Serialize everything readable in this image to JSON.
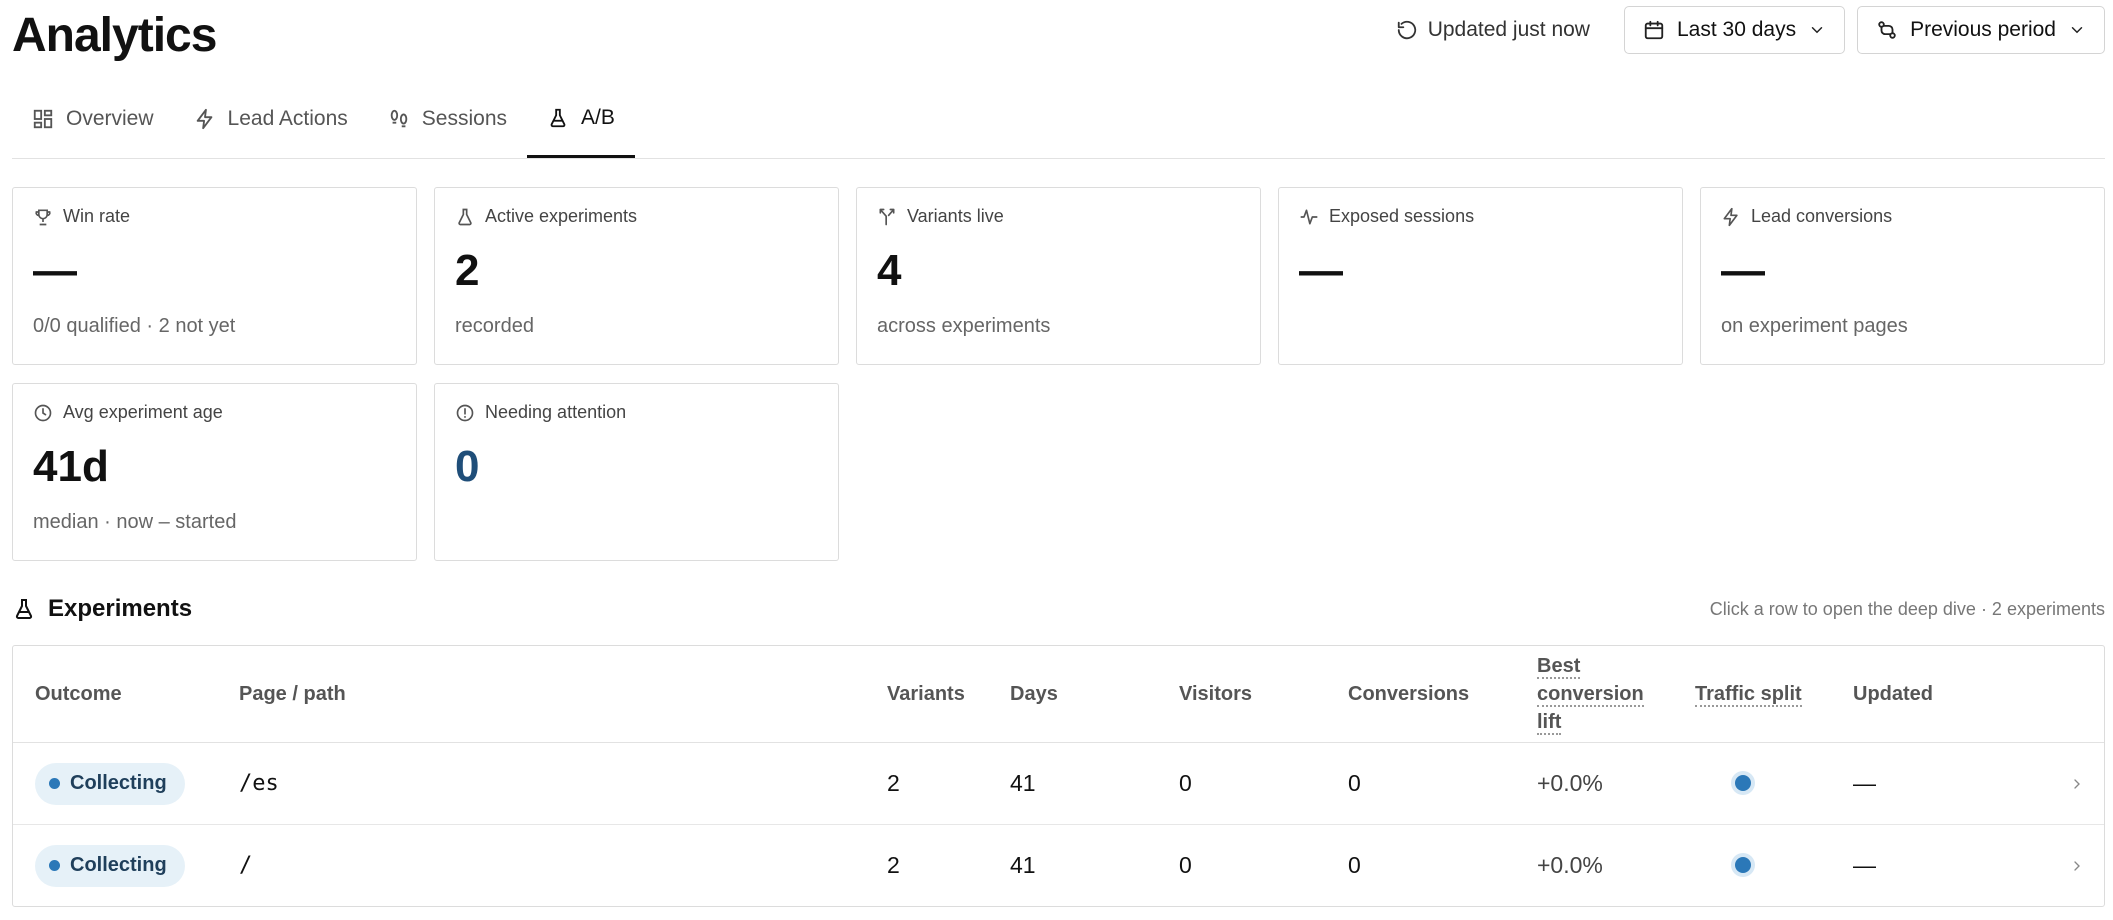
{
  "header": {
    "title": "Analytics",
    "updated_label": "Updated just now",
    "range_label": "Last 30 days",
    "compare_label": "Previous period"
  },
  "tabs": [
    {
      "label": "Overview",
      "icon": "grid-icon",
      "active": false
    },
    {
      "label": "Lead Actions",
      "icon": "bolt-icon",
      "active": false
    },
    {
      "label": "Sessions",
      "icon": "footprints-icon",
      "active": false
    },
    {
      "label": "A/B",
      "icon": "flask-icon",
      "active": true
    }
  ],
  "kpis": [
    {
      "label": "Win rate",
      "icon": "trophy-icon",
      "value": "—",
      "sub": "0/0 qualified · 2 not yet"
    },
    {
      "label": "Active experiments",
      "icon": "flask-icon",
      "value": "2",
      "sub": "recorded"
    },
    {
      "label": "Variants live",
      "icon": "split-icon",
      "value": "4",
      "sub": "across experiments"
    },
    {
      "label": "Exposed sessions",
      "icon": "activity-icon",
      "value": "—",
      "sub": ""
    },
    {
      "label": "Lead conversions",
      "icon": "bolt-icon",
      "value": "—",
      "sub": "on experiment pages"
    },
    {
      "label": "Avg experiment age",
      "icon": "clock-icon",
      "value": "41d",
      "sub": "median · now – started"
    },
    {
      "label": "Needing attention",
      "icon": "alert-circle-icon",
      "value": "0",
      "sub": ""
    }
  ],
  "experiments": {
    "title": "Experiments",
    "hint": "Click a row to open the deep dive · 2 experiments",
    "columns": {
      "outcome": "Outcome",
      "page": "Page / path",
      "variants": "Variants",
      "days": "Days",
      "visitors": "Visitors",
      "conversions": "Conversions",
      "lift_line1": "Best conversion",
      "lift_line2": "lift",
      "split": "Traffic split",
      "updated": "Updated"
    },
    "rows": [
      {
        "outcome": "Collecting",
        "path": "/es",
        "variants": "2",
        "days": "41",
        "visitors": "0",
        "conversions": "0",
        "lift": "+0.0%",
        "updated": "—"
      },
      {
        "outcome": "Collecting",
        "path": "/",
        "variants": "2",
        "days": "41",
        "visitors": "0",
        "conversions": "0",
        "lift": "+0.0%",
        "updated": "—"
      }
    ]
  },
  "colors": {
    "accent": "#1f4e79",
    "status_dot": "#2b78b8",
    "badge_bg": "#e6f1f8"
  }
}
